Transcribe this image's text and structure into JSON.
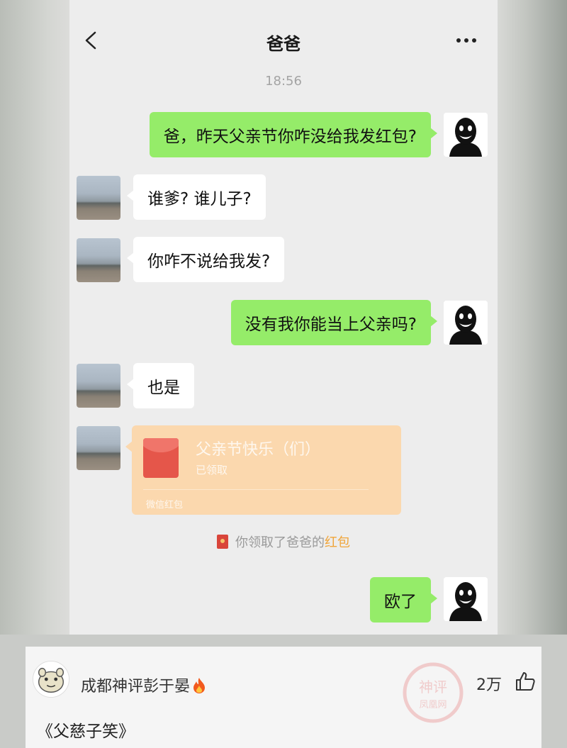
{
  "chat": {
    "title": "爸爸",
    "timestamp": "18:56",
    "messages": [
      {
        "from": "me",
        "text": "爸，昨天父亲节你咋没给我发红包?"
      },
      {
        "from": "dad",
        "text": "谁爹? 谁儿子?"
      },
      {
        "from": "dad",
        "text": "你咋不说给我发?"
      },
      {
        "from": "me",
        "text": "没有我你能当上父亲吗?"
      },
      {
        "from": "dad",
        "text": "也是"
      },
      {
        "from": "me",
        "text": "欧了"
      }
    ],
    "red_packet": {
      "title": "父亲节快乐（们）",
      "status": "已领取",
      "footer": "微信红包",
      "color": "#fbd8ae"
    },
    "notice": {
      "prefix": "你领取了爸爸的",
      "highlight": "红包"
    },
    "colors": {
      "my_bubble": "#95ec69",
      "dad_bubble": "#ffffff",
      "background": "#ededed"
    }
  },
  "comment": {
    "username": "成都神评彭于晏",
    "user_badge_icon": "fire-icon",
    "text": "《父慈子笑》",
    "likes": "2万",
    "watermark_text": [
      "神评",
      "凤凰网"
    ]
  }
}
